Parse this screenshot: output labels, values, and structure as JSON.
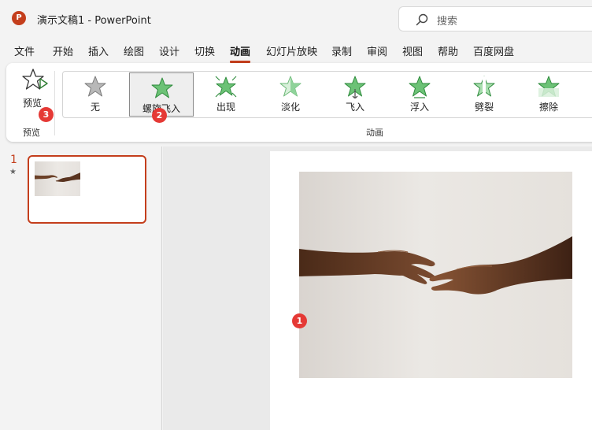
{
  "app": {
    "icon_letter": "P",
    "title": "演示文稿1  -  PowerPoint",
    "accent_color": "#c43e1c"
  },
  "search": {
    "placeholder": "搜索",
    "icon": "search-icon"
  },
  "menu": {
    "tabs": [
      "文件",
      "开始",
      "插入",
      "绘图",
      "设计",
      "切换",
      "动画",
      "幻灯片放映",
      "录制",
      "审阅",
      "视图",
      "帮助",
      "百度网盘"
    ],
    "active": "动画"
  },
  "ribbon": {
    "preview": {
      "label": "预览",
      "chevron": "⌄",
      "group_label": "预览",
      "icon": "star-play-icon"
    },
    "animation_group": {
      "label": "动画",
      "items": [
        {
          "label": "无",
          "icon": "star-gray-icon"
        },
        {
          "label": "螺旋飞入",
          "icon": "star-green-icon",
          "selected": true
        },
        {
          "label": "出现",
          "icon": "star-burst-icon"
        },
        {
          "label": "淡化",
          "icon": "star-fade-icon"
        },
        {
          "label": "飞入",
          "icon": "star-fly-icon"
        },
        {
          "label": "浮入",
          "icon": "star-float-icon"
        },
        {
          "label": "劈裂",
          "icon": "star-split-icon"
        },
        {
          "label": "擦除",
          "icon": "star-wipe-icon"
        }
      ]
    }
  },
  "badges": {
    "photo": "1",
    "spiral": "2",
    "preview": "3",
    "color": "#e53935"
  },
  "thumbnails": {
    "slide_number": "1",
    "animation_marker": "★"
  }
}
